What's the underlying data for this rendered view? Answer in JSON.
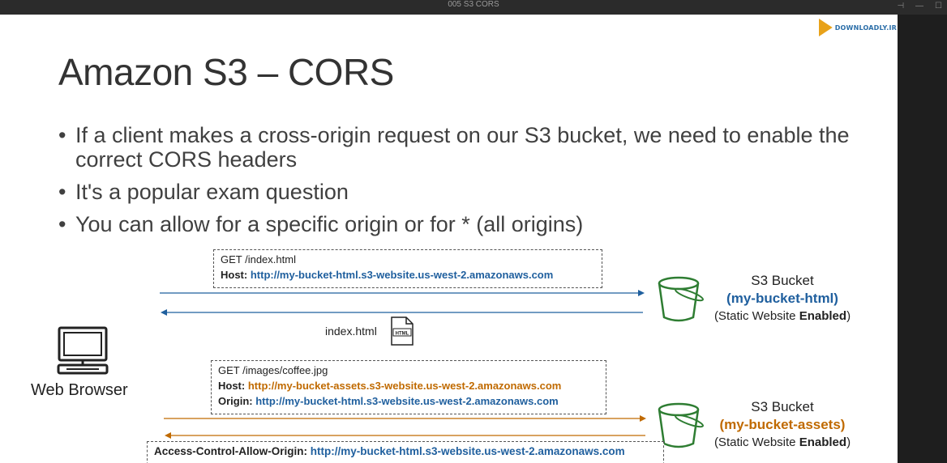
{
  "window": {
    "title": "005 S3 CORS"
  },
  "logo": {
    "text": "DOWNLOADLY.IR"
  },
  "slide": {
    "title": "Amazon S3 – CORS",
    "bullets": [
      "If a client makes a cross-origin request on our S3 bucket, we need to enable the correct CORS headers",
      "It's a popular exam question",
      "You can allow for a specific origin or for * (all origins)"
    ]
  },
  "diagram": {
    "browser_label": "Web Browser",
    "request1": {
      "line1": "GET /index.html",
      "host_label": "Host:",
      "host_value": "http://my-bucket-html.s3-website.us-west-2.amazonaws.com"
    },
    "file_label": "index.html",
    "file_icon_text": "HTML",
    "bucket1": {
      "title": "S3 Bucket",
      "name": "(my-bucket-html)",
      "status_prefix": "(Static Website ",
      "status_bold": "Enabled",
      "status_suffix": ")"
    },
    "request2": {
      "line1": "GET /images/coffee.jpg",
      "host_label": "Host:",
      "host_value": "http://my-bucket-assets.s3-website.us-west-2.amazonaws.com",
      "origin_label": "Origin:",
      "origin_value": "http://my-bucket-html.s3-website.us-west-2.amazonaws.com"
    },
    "bucket2": {
      "title": "S3 Bucket",
      "name": "(my-bucket-assets)",
      "status_prefix": "(Static Website ",
      "status_bold": "Enabled",
      "status_suffix": ")"
    },
    "response2": {
      "label": "Access-Control-Allow-Origin:",
      "value": "http://my-bucket-html.s3-website.us-west-2.amazonaws.com"
    },
    "colors": {
      "blue": "#1f5f9e",
      "orange": "#c06a00",
      "bucket_green": "#2e7d32"
    }
  }
}
